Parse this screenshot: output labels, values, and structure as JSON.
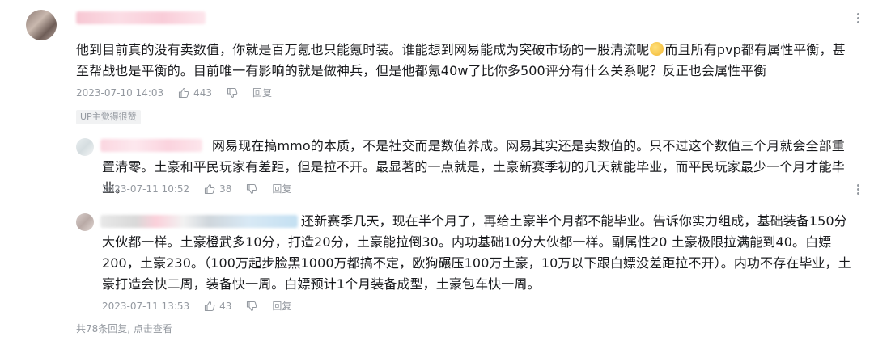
{
  "comment": {
    "username": "",
    "text": "他到目前真的没有卖数值，你就是百万氪也只能氪时装。谁能想到网易能成为突破市场的一股清流呢",
    "text_after_emoji": "而且所有pvp都有属性平衡，甚至帮战也是平衡的。目前唯一有影响的就是做神兵，但是他都氪40w了比你多500评分有什么关系呢？反正也会属性平衡",
    "date": "2023-07-10 14:03",
    "likes": "443",
    "reply_label": "回复",
    "badge": "UP主觉得很赞"
  },
  "replies": [
    {
      "text": "网易现在搞mmo的本质，不是社交而是数值养成。网易其实还是卖数值的。只不过这个数值三个月就会全部重置清零。土豪和平民玩家有差距，但是拉不开。最显著的一点就是，土豪新赛季初的几天就能毕业，而平民玩家最少一个月才能毕业。",
      "date": "2023-07-11 10:52",
      "likes": "38",
      "reply_label": "回复"
    },
    {
      "text": "还新赛季几天，现在半个月了，再给土豪半个月都不能毕业。告诉你实力组成，基础装备150分大伙都一样。土豪橙武多10分，打造20分，土豪能拉倒30。内功基础10分大伙都一样。副属性20 土豪极限拉满能到40。白嫖200，土豪230。（100万起步脸黑1000万都搞不定，欧狗碾压100万土豪，10万以下跟白嫖没差距拉不开）。内功不存在毕业，土豪打造会快二周，装备快一周。白嫖预计1个月装备成型，土豪包车快一周。",
      "date": "2023-07-11 13:53",
      "likes": "43",
      "reply_label": "回复"
    }
  ],
  "footer": "共78条回复, 点击查看",
  "colors": {
    "meta": "#9499a0",
    "text": "#18191c",
    "badge_bg": "#f1f2f3"
  }
}
